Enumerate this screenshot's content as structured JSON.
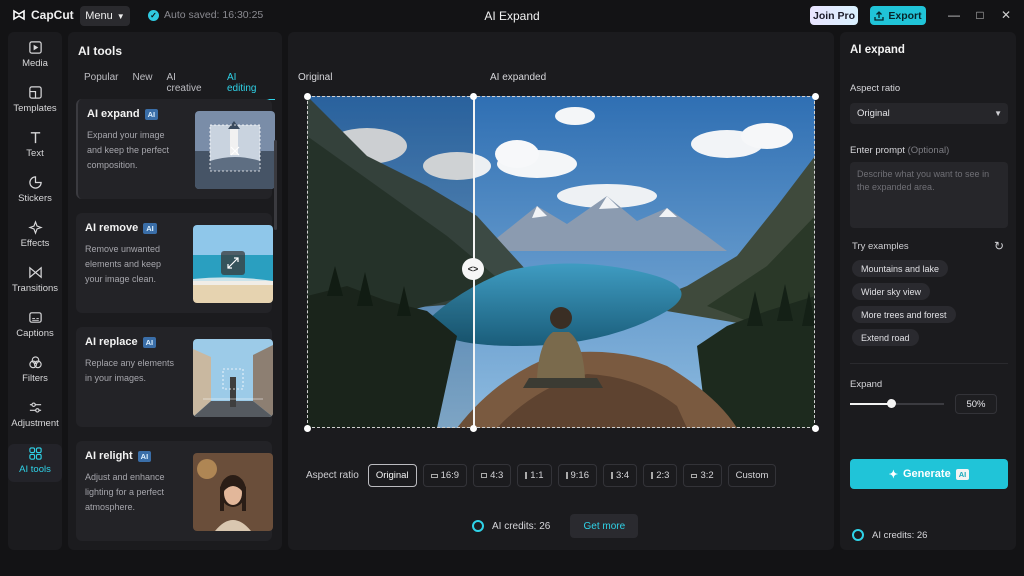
{
  "app": {
    "name": "CapCut",
    "menu_label": "Menu",
    "autosave_text": "Auto saved: 16:30:25",
    "window_title": "AI Expand",
    "join_pro_label": "Join Pro",
    "export_label": "Export"
  },
  "rail": {
    "items": [
      {
        "label": "Media",
        "icon": "media-icon"
      },
      {
        "label": "Templates",
        "icon": "templates-icon"
      },
      {
        "label": "Text",
        "icon": "text-icon"
      },
      {
        "label": "Stickers",
        "icon": "stickers-icon"
      },
      {
        "label": "Effects",
        "icon": "effects-icon"
      },
      {
        "label": "Transitions",
        "icon": "transitions-icon"
      },
      {
        "label": "Captions",
        "icon": "captions-icon"
      },
      {
        "label": "Filters",
        "icon": "filters-icon"
      },
      {
        "label": "Adjustment",
        "icon": "adjustment-icon"
      },
      {
        "label": "AI tools",
        "icon": "ai-tools-icon",
        "active": true
      }
    ]
  },
  "tools_panel": {
    "title": "AI tools",
    "tabs": [
      "Popular",
      "New",
      "AI creative",
      "AI editing"
    ],
    "active_tab": "AI editing",
    "badge": "AI",
    "cards": [
      {
        "name": "AI expand",
        "desc": "Expand your image and keep the perfect composition."
      },
      {
        "name": "AI remove",
        "desc": "Remove unwanted elements and keep your image clean."
      },
      {
        "name": "AI replace",
        "desc": "Replace any elements in your images."
      },
      {
        "name": "AI relight",
        "desc": "Adjust and enhance lighting for a perfect atmosphere."
      }
    ]
  },
  "canvas": {
    "label_original": "Original",
    "label_expanded": "AI expanded",
    "aspect_label": "Aspect ratio",
    "ratios": [
      "Original",
      "16:9",
      "4:3",
      "1:1",
      "9:16",
      "3:4",
      "2:3",
      "3:2",
      "Custom"
    ],
    "active_ratio": "Original",
    "credits_text": "AI credits: 26",
    "get_more_label": "Get more"
  },
  "right_panel": {
    "title": "AI expand",
    "aspect_label": "Aspect ratio",
    "aspect_value": "Original",
    "prompt_label": "Enter prompt",
    "prompt_optional": "(Optional)",
    "prompt_placeholder": "Describe what you want to see in the expanded area.",
    "examples_label": "Try examples",
    "examples": [
      "Mountains and lake",
      "Wider sky view",
      "More trees and forest",
      "Extend road"
    ],
    "expand_label": "Expand",
    "expand_percent": 50,
    "expand_display": "50%",
    "generate_label": "Generate",
    "generate_badge": "AI",
    "credits_text": "AI credits: 26"
  },
  "colors": {
    "accent": "#20c4d8",
    "background": "#131315",
    "panel": "#1b1b1e"
  }
}
